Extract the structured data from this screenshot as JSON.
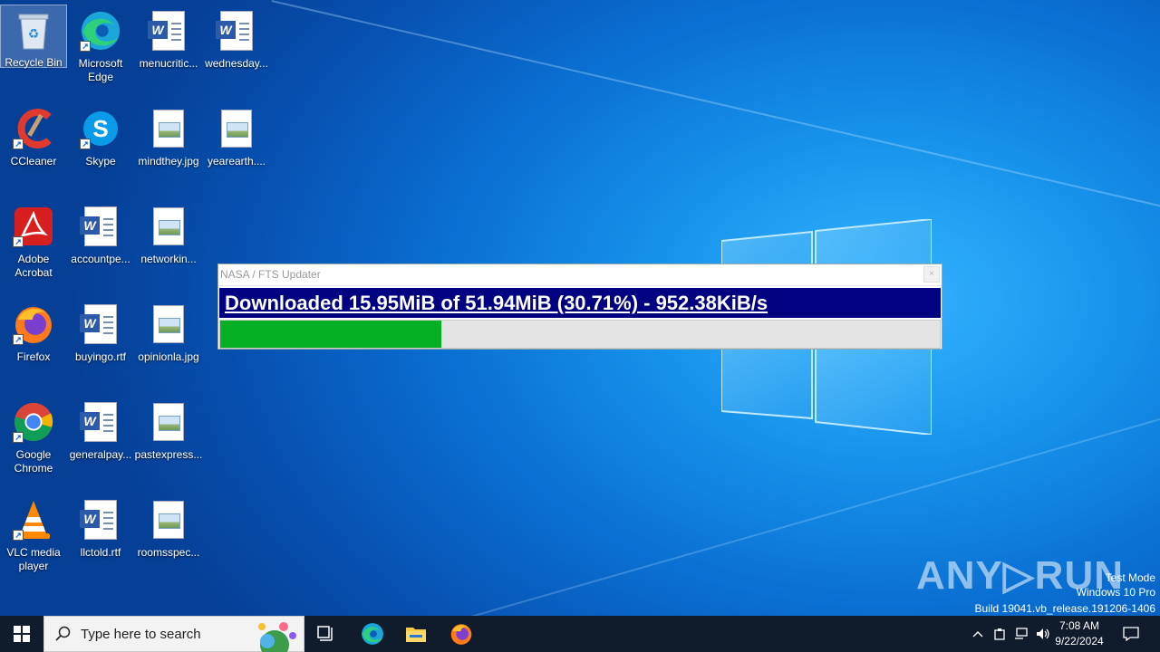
{
  "desktop": {
    "icons": [
      {
        "label": "Recycle Bin"
      },
      {
        "label": "Microsoft Edge"
      },
      {
        "label": "menucritic..."
      },
      {
        "label": "wednesday..."
      },
      {
        "label": "CCleaner"
      },
      {
        "label": "Skype"
      },
      {
        "label": "mindthey.jpg"
      },
      {
        "label": "yearearth...."
      },
      {
        "label": "Adobe Acrobat"
      },
      {
        "label": "accountpe..."
      },
      {
        "label": "networkin..."
      },
      {
        "label": "Firefox"
      },
      {
        "label": "buyingo.rtf"
      },
      {
        "label": "opinionla.jpg"
      },
      {
        "label": "Google Chrome"
      },
      {
        "label": "generalpay..."
      },
      {
        "label": "pastexpress..."
      },
      {
        "label": "VLC media player"
      },
      {
        "label": "llctold.rtf"
      },
      {
        "label": "roomsspec..."
      }
    ]
  },
  "updater": {
    "title": "NASA / FTS Updater",
    "close_label": "×",
    "status_text": "Downloaded 15.95MiB of 51.94MiB (30.71%) - 952.38KiB/s",
    "progress_fraction": 0.3071,
    "progress_color": "#06b025",
    "status_bg": "#000080"
  },
  "watermark": {
    "brand": "ANY▷RUN",
    "line1": "Test Mode",
    "line2": "Windows 10 Pro",
    "line3": "Build 19041.vb_release.191206-1406"
  },
  "taskbar": {
    "search_placeholder": "Type here to search",
    "time": "7:08 AM",
    "date": "9/22/2024",
    "pinned": [
      "task-view-icon",
      "edge-icon",
      "file-explorer-icon",
      "firefox-icon"
    ]
  }
}
